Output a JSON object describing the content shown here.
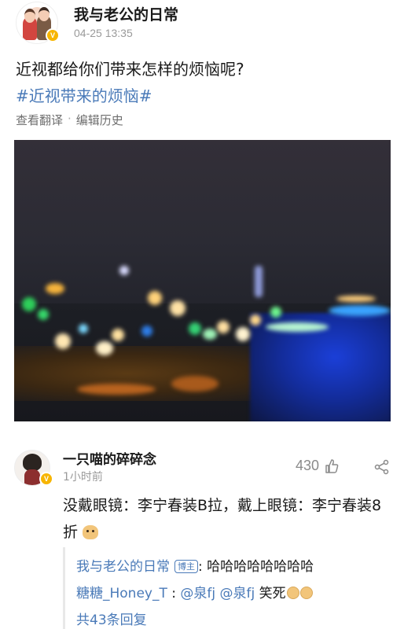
{
  "post": {
    "author": "我与老公的日常",
    "time": "04-25 13:35",
    "text": "近视都给你们带来怎样的烦恼呢?",
    "hashtag": "#近视带来的烦恼#",
    "actions": {
      "translate": "查看翻译",
      "separator": "·",
      "edit_history": "编辑历史"
    },
    "verified_badge": "V"
  },
  "comment": {
    "author": "一只喵的碎碎念",
    "time": "1小时前",
    "likes": "430",
    "text": "没戴眼镜：李宁春装B拉，戴上眼镜：李宁春装8折",
    "verified_badge": "V",
    "replies": [
      {
        "user": "我与老公的日常",
        "badge": "博主",
        "separator": ":",
        "text": "哈哈哈哈哈哈哈哈"
      },
      {
        "user": "糖糖_Honey_T",
        "separator": ":",
        "mention1": "@泉fj",
        "mention2": "@泉fj",
        "text": "笑死"
      }
    ],
    "more_replies": "共43条回复"
  },
  "icons": {
    "like": "thumbs-up-icon",
    "share": "share-icon",
    "emoji": "dog-face-emoji"
  },
  "colors": {
    "link": "#4a7ab8",
    "badge": "#f7b500"
  }
}
